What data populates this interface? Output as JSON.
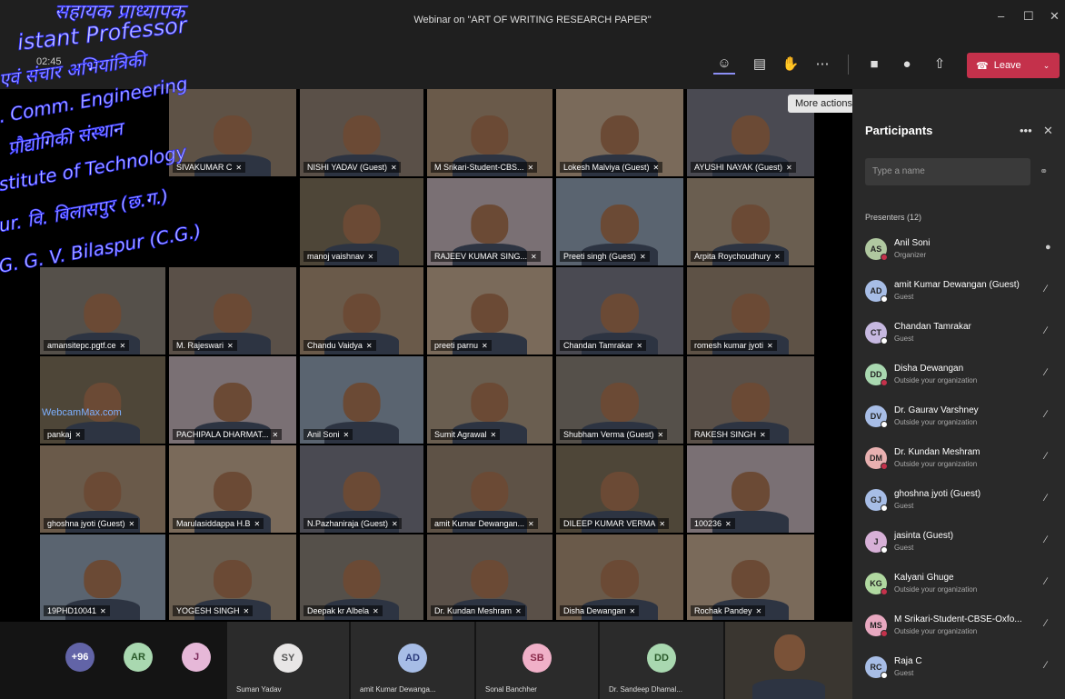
{
  "window": {
    "title": "Webinar on \"ART OF WRITING RESEARCH PAPER\"",
    "minimize": "–",
    "maximize": "☐",
    "close": "✕"
  },
  "toolbar": {
    "time": "02:45",
    "more_tooltip": "More actions",
    "leave_label": "Leave"
  },
  "tiles": [
    {
      "name": "NISHI YADAV (Guest)"
    },
    {
      "name": "M Srikari-Student-CBS..."
    },
    {
      "name": "Lokesh Malviya (Guest)"
    },
    {
      "name": "AYUSHI NAYAK (Guest)"
    },
    {
      "name": "SIVAKUMAR C"
    },
    {
      "name": "manoj vaishnav"
    },
    {
      "name": "RAJEEV KUMAR SING..."
    },
    {
      "name": "Preeti singh (Guest)"
    },
    {
      "name": "Arpita Roychoudhury"
    },
    {
      "name": "amansitepc.pgtf.ce"
    },
    {
      "name": "M. Rajeswari"
    },
    {
      "name": "Chandu Vaidya"
    },
    {
      "name": "preeti parnu"
    },
    {
      "name": "Chandan Tamrakar"
    },
    {
      "name": "romesh kumar jyoti"
    },
    {
      "name": "pankaj"
    },
    {
      "name": "PACHIPALA DHARMAT..."
    },
    {
      "name": "Anil Soni"
    },
    {
      "name": "Sumit Agrawal"
    },
    {
      "name": "Shubham Verma (Guest)"
    },
    {
      "name": "RAKESH SINGH"
    },
    {
      "name": "ghoshna jyoti (Guest)"
    },
    {
      "name": "Marulasiddappa H.B"
    },
    {
      "name": "N.Pazhaniraja (Guest)"
    },
    {
      "name": "amit Kumar Dewangan..."
    },
    {
      "name": "DILEEP KUMAR VERMA"
    },
    {
      "name": "100236"
    },
    {
      "name": "19PHD10041"
    },
    {
      "name": "YOGESH SINGH"
    },
    {
      "name": "Deepak kr Albela"
    },
    {
      "name": "Dr. Kundan Meshram"
    },
    {
      "name": "Disha Dewangan"
    },
    {
      "name": "Rochak Pandey"
    }
  ],
  "overflow": {
    "count": "+96",
    "a1": "AR",
    "a2": "J"
  },
  "bottom_slots": [
    {
      "initials": "SY",
      "name": "Suman Yadav"
    },
    {
      "initials": "AD",
      "name": "amit Kumar Dewanga..."
    },
    {
      "initials": "SB",
      "name": "Sonal Banchher"
    },
    {
      "initials": "DD",
      "name": "Dr. Sandeep Dhamal..."
    }
  ],
  "watermark": "WebcamMax.com",
  "stamp_text": "सहायक प्राध्यापक / Assistant Professor / इलेक्ट्रॉनिक्स एवं संचार अभियांत्रिकी / Electronics & Comm. Engineering / प्रौद्योगिकी संस्थान / Institute of Technology / गु. घा. वि. बिलासपुर (छ.ग.) / G. G. V. Bilaspur (C.G.)",
  "panel": {
    "title": "Participants",
    "more": "•••",
    "close": "✕",
    "search_placeholder": "Type a name",
    "section": "Presenters (12)",
    "participants": [
      {
        "initials": "AS",
        "name": "Anil Soni",
        "sub": "Organizer",
        "color": "#b0c8a0",
        "status": "#c4314b"
      },
      {
        "initials": "AD",
        "name": "amit Kumar Dewangan (Guest)",
        "sub": "Guest",
        "color": "#a7bde6",
        "status": "#fff"
      },
      {
        "initials": "CT",
        "name": "Chandan Tamrakar",
        "sub": "Guest",
        "color": "#c6b8e0",
        "status": "#fff"
      },
      {
        "initials": "DD",
        "name": "Disha Dewangan",
        "sub": "Outside your organization",
        "color": "#a9d8b0",
        "status": "#c4314b"
      },
      {
        "initials": "DV",
        "name": "Dr. Gaurav Varshney",
        "sub": "Outside your organization",
        "color": "#a7bde6",
        "status": "#fff"
      },
      {
        "initials": "DM",
        "name": "Dr. Kundan Meshram",
        "sub": "Outside your organization",
        "color": "#e8b0b0",
        "status": "#c4314b"
      },
      {
        "initials": "GJ",
        "name": "ghoshna jyoti (Guest)",
        "sub": "Guest",
        "color": "#a7bde6",
        "status": "#fff"
      },
      {
        "initials": "J",
        "name": "jasinta (Guest)",
        "sub": "Guest",
        "color": "#d7b0d7",
        "status": "#fff"
      },
      {
        "initials": "KG",
        "name": "Kalyani Ghuge",
        "sub": "Outside your organization",
        "color": "#b0d8a0",
        "status": "#c4314b"
      },
      {
        "initials": "MS",
        "name": "M Srikari-Student-CBSE-Oxfo...",
        "sub": "Outside your organization",
        "color": "#e8a8c0",
        "status": "#c4314b"
      },
      {
        "initials": "RC",
        "name": "Raja C",
        "sub": "Guest",
        "color": "#a7bde6",
        "status": "#fff"
      }
    ]
  }
}
